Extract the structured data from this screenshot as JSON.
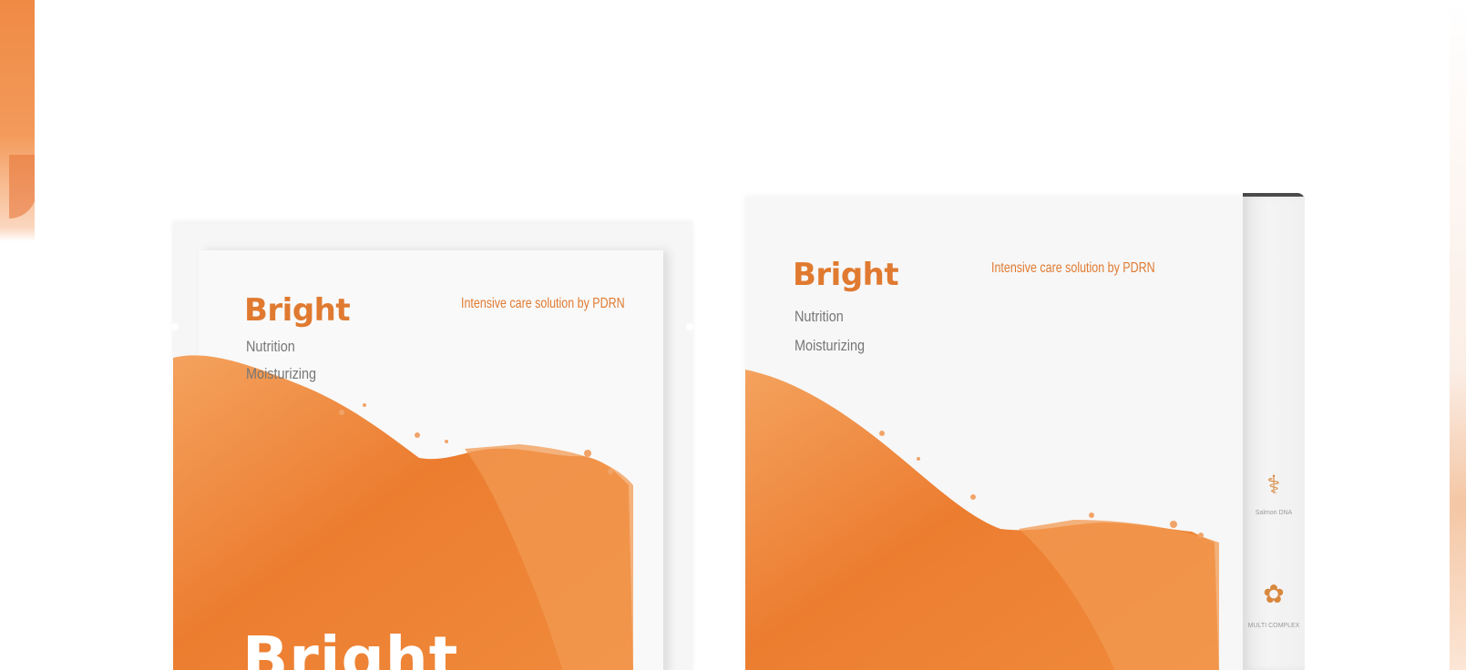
{
  "colors": {
    "accent": "#e07a30",
    "splash_dark": "#e8722a",
    "splash_light": "#f4a25e",
    "packaging": "#f7f7f7"
  },
  "pouch": {
    "brand": "Bright",
    "subtitle_1": "Nutrition",
    "subtitle_2": "Moisturizing",
    "tagline": "Intensive care solution by PDRN",
    "big_brand": "Bright"
  },
  "box": {
    "brand": "Bright",
    "subtitle_1": "Nutrition",
    "subtitle_2": "Moisturizing",
    "tagline": "Intensive care solution by PDRN",
    "side_icons": [
      {
        "icon": "salmon-dna-icon",
        "label": "Salmon DNA"
      },
      {
        "icon": "multi-complex-icon",
        "label": "MULTI COMPLEX"
      }
    ]
  }
}
